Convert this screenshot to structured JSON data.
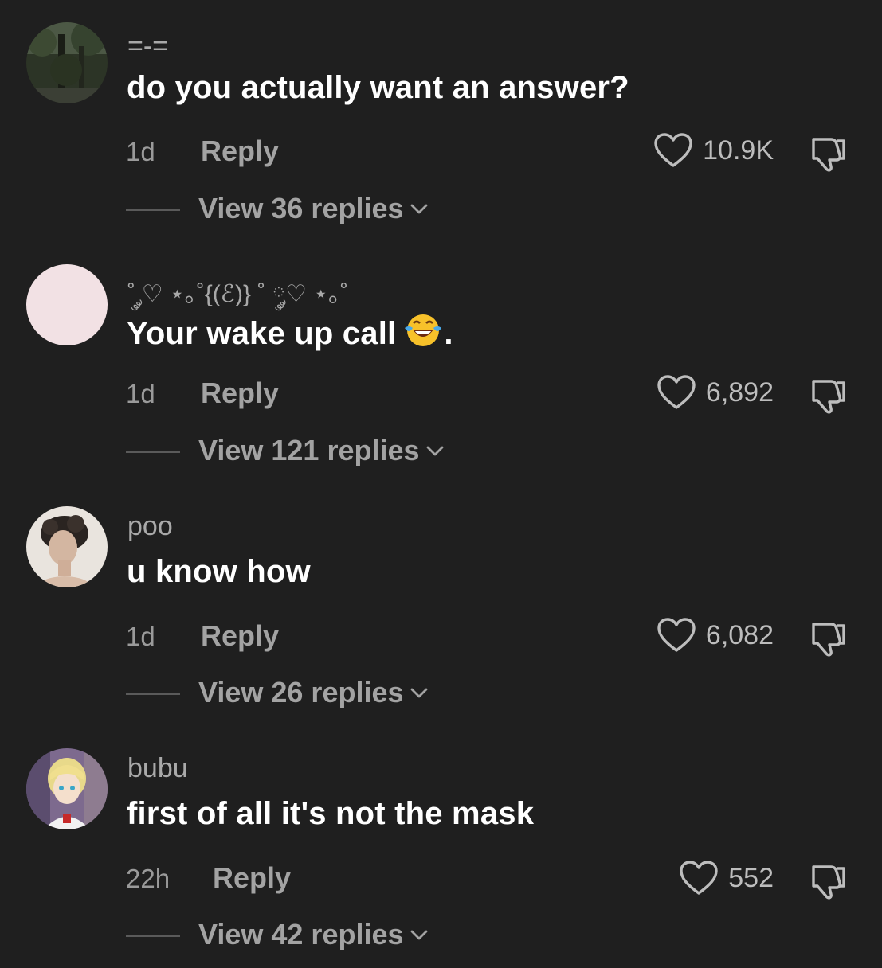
{
  "comments": [
    {
      "username": "=-=",
      "text": "do you actually want an answer?",
      "emoji": "",
      "tail": "",
      "time": "1d",
      "reply_label": "Reply",
      "likes": "10.9K",
      "view_replies": "View 36 replies",
      "avatar": "forest-avatar"
    },
    {
      "username": "˚ ༘♡ ⋆｡˚{(ℰ)} ˚ ༘♡ ⋆｡˚",
      "text": "Your wake up call",
      "emoji": "face-with-tears-of-joy",
      "tail": ".",
      "time": "1d",
      "reply_label": "Reply",
      "likes": "6,892",
      "view_replies": "View 121 replies",
      "avatar": "pink-avatar"
    },
    {
      "username": "poo",
      "text": "u know how",
      "emoji": "",
      "tail": "",
      "time": "1d",
      "reply_label": "Reply",
      "likes": "6,082",
      "view_replies": "View 26 replies",
      "avatar": "portrait-avatar"
    },
    {
      "username": "bubu",
      "text": "first of all it's not the mask",
      "emoji": "",
      "tail": "",
      "time": "22h",
      "reply_label": "Reply",
      "likes": "552",
      "view_replies": "View 42 replies",
      "avatar": "anime-avatar"
    }
  ],
  "colors": {
    "background": "#1f1f1f",
    "primary_text": "#ffffff",
    "secondary_text": "#a3a3a3",
    "divider": "#5a5a5a"
  }
}
